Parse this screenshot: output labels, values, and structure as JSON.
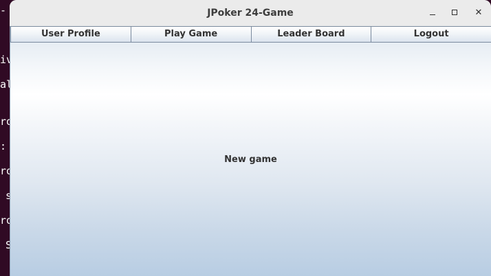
{
  "terminal": {
    "fragments": [
      "-",
      "iv",
      "al",
      "ro",
      ":",
      "ro",
      "s",
      "ro",
      "S"
    ]
  },
  "window": {
    "title": "JPoker 24-Game",
    "controls": {
      "minimize": "minimize-icon",
      "maximize": "maximize-icon",
      "close": "close-icon"
    }
  },
  "menu": {
    "user_profile": "User Profile",
    "play_game": "Play Game",
    "leader_board": "Leader Board",
    "logout": "Logout"
  },
  "main": {
    "status": "New game"
  },
  "colors": {
    "terminal_bg": "#300a24",
    "titlebar_bg": "#ebebeb",
    "panel_top": "#ffffff",
    "panel_bottom": "#b8cde3"
  }
}
